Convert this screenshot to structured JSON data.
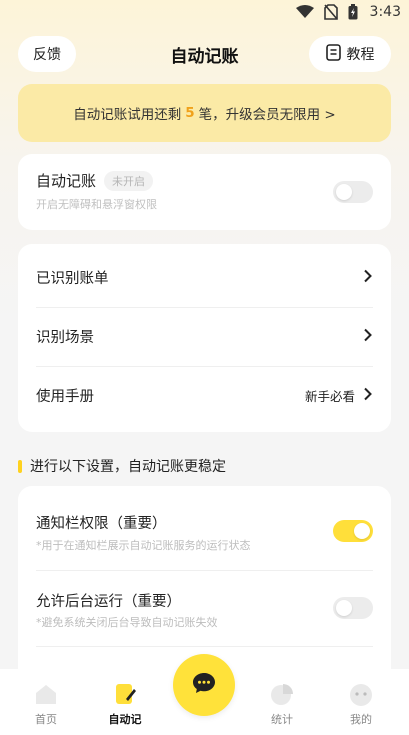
{
  "status_bar": {
    "time": "3:43"
  },
  "header": {
    "feedback_label": "反馈",
    "title": "自动记账",
    "tutorial_label": "教程"
  },
  "trial_banner": {
    "prefix": "自动记账试用还剩",
    "count": "5",
    "suffix": "笔，升级会员无限用 >"
  },
  "auto_card": {
    "title": "自动记账",
    "badge": "未开启",
    "subtitle": "开启无障碍和悬浮窗权限",
    "enabled": false
  },
  "menu": {
    "items": [
      {
        "label": "已识别账单",
        "extra": ""
      },
      {
        "label": "识别场景",
        "extra": ""
      },
      {
        "label": "使用手册",
        "extra": "新手必看"
      }
    ]
  },
  "section": {
    "title": "进行以下设置，自动记账更稳定"
  },
  "settings": {
    "items": [
      {
        "title": "通知栏权限（重要）",
        "subtitle": "*用于在通知栏展示自动记账服务的运行状态",
        "enabled": true
      },
      {
        "title": "允许后台运行（重要）",
        "subtitle": "*避免系统关闭后台导致自动记账失效",
        "enabled": false
      }
    ]
  },
  "tabbar": {
    "tabs": [
      {
        "label": "首页"
      },
      {
        "label": "自动记"
      },
      {
        "label": "统计"
      },
      {
        "label": "我的"
      }
    ],
    "active": "自动记"
  },
  "colors": {
    "accent": "#ffdf3a",
    "banner": "#fbeaa6",
    "highlight": "#f0a11a"
  }
}
